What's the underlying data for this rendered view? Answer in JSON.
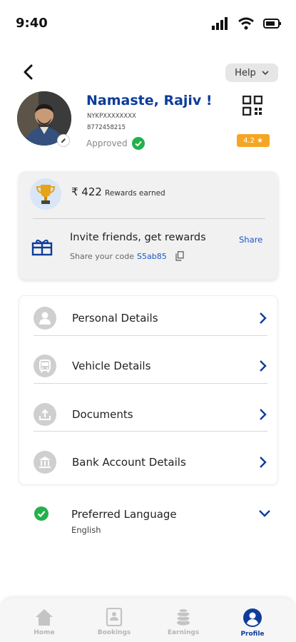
{
  "status_bar": {
    "time": "9:40"
  },
  "header": {
    "help_label": "Help"
  },
  "profile": {
    "greeting": "Namaste, Rajiv !",
    "user_id": "NYKPXXXXXXXX",
    "phone": "8772458215",
    "status": "Approved",
    "rating": "4.2"
  },
  "rewards": {
    "amount": "₹ 422",
    "label": "Rewards earned",
    "invite_title": "Invite friends, get rewards",
    "share_label": "Share",
    "code_label": "Share your code",
    "code": "S5ab85"
  },
  "details": {
    "items": [
      {
        "label": "Personal Details",
        "icon": "person-icon"
      },
      {
        "label": "Vehicle Details",
        "icon": "bus-icon"
      },
      {
        "label": "Documents",
        "icon": "upload-icon"
      },
      {
        "label": "Bank Account Details",
        "icon": "bank-icon"
      }
    ]
  },
  "language": {
    "title": "Preferred Language",
    "value": "English"
  },
  "nav": {
    "items": [
      {
        "label": "Home",
        "icon": "home-icon",
        "active": false
      },
      {
        "label": "Bookings",
        "icon": "bookings-icon",
        "active": false
      },
      {
        "label": "Earnings",
        "icon": "coins-icon",
        "active": false
      },
      {
        "label": "Profile",
        "icon": "profile-icon",
        "active": true
      }
    ]
  },
  "colors": {
    "brand_blue": "#0d3d9a",
    "link_blue": "#1a56c4",
    "success_green": "#22b14c",
    "rating_orange": "#f5a623"
  }
}
